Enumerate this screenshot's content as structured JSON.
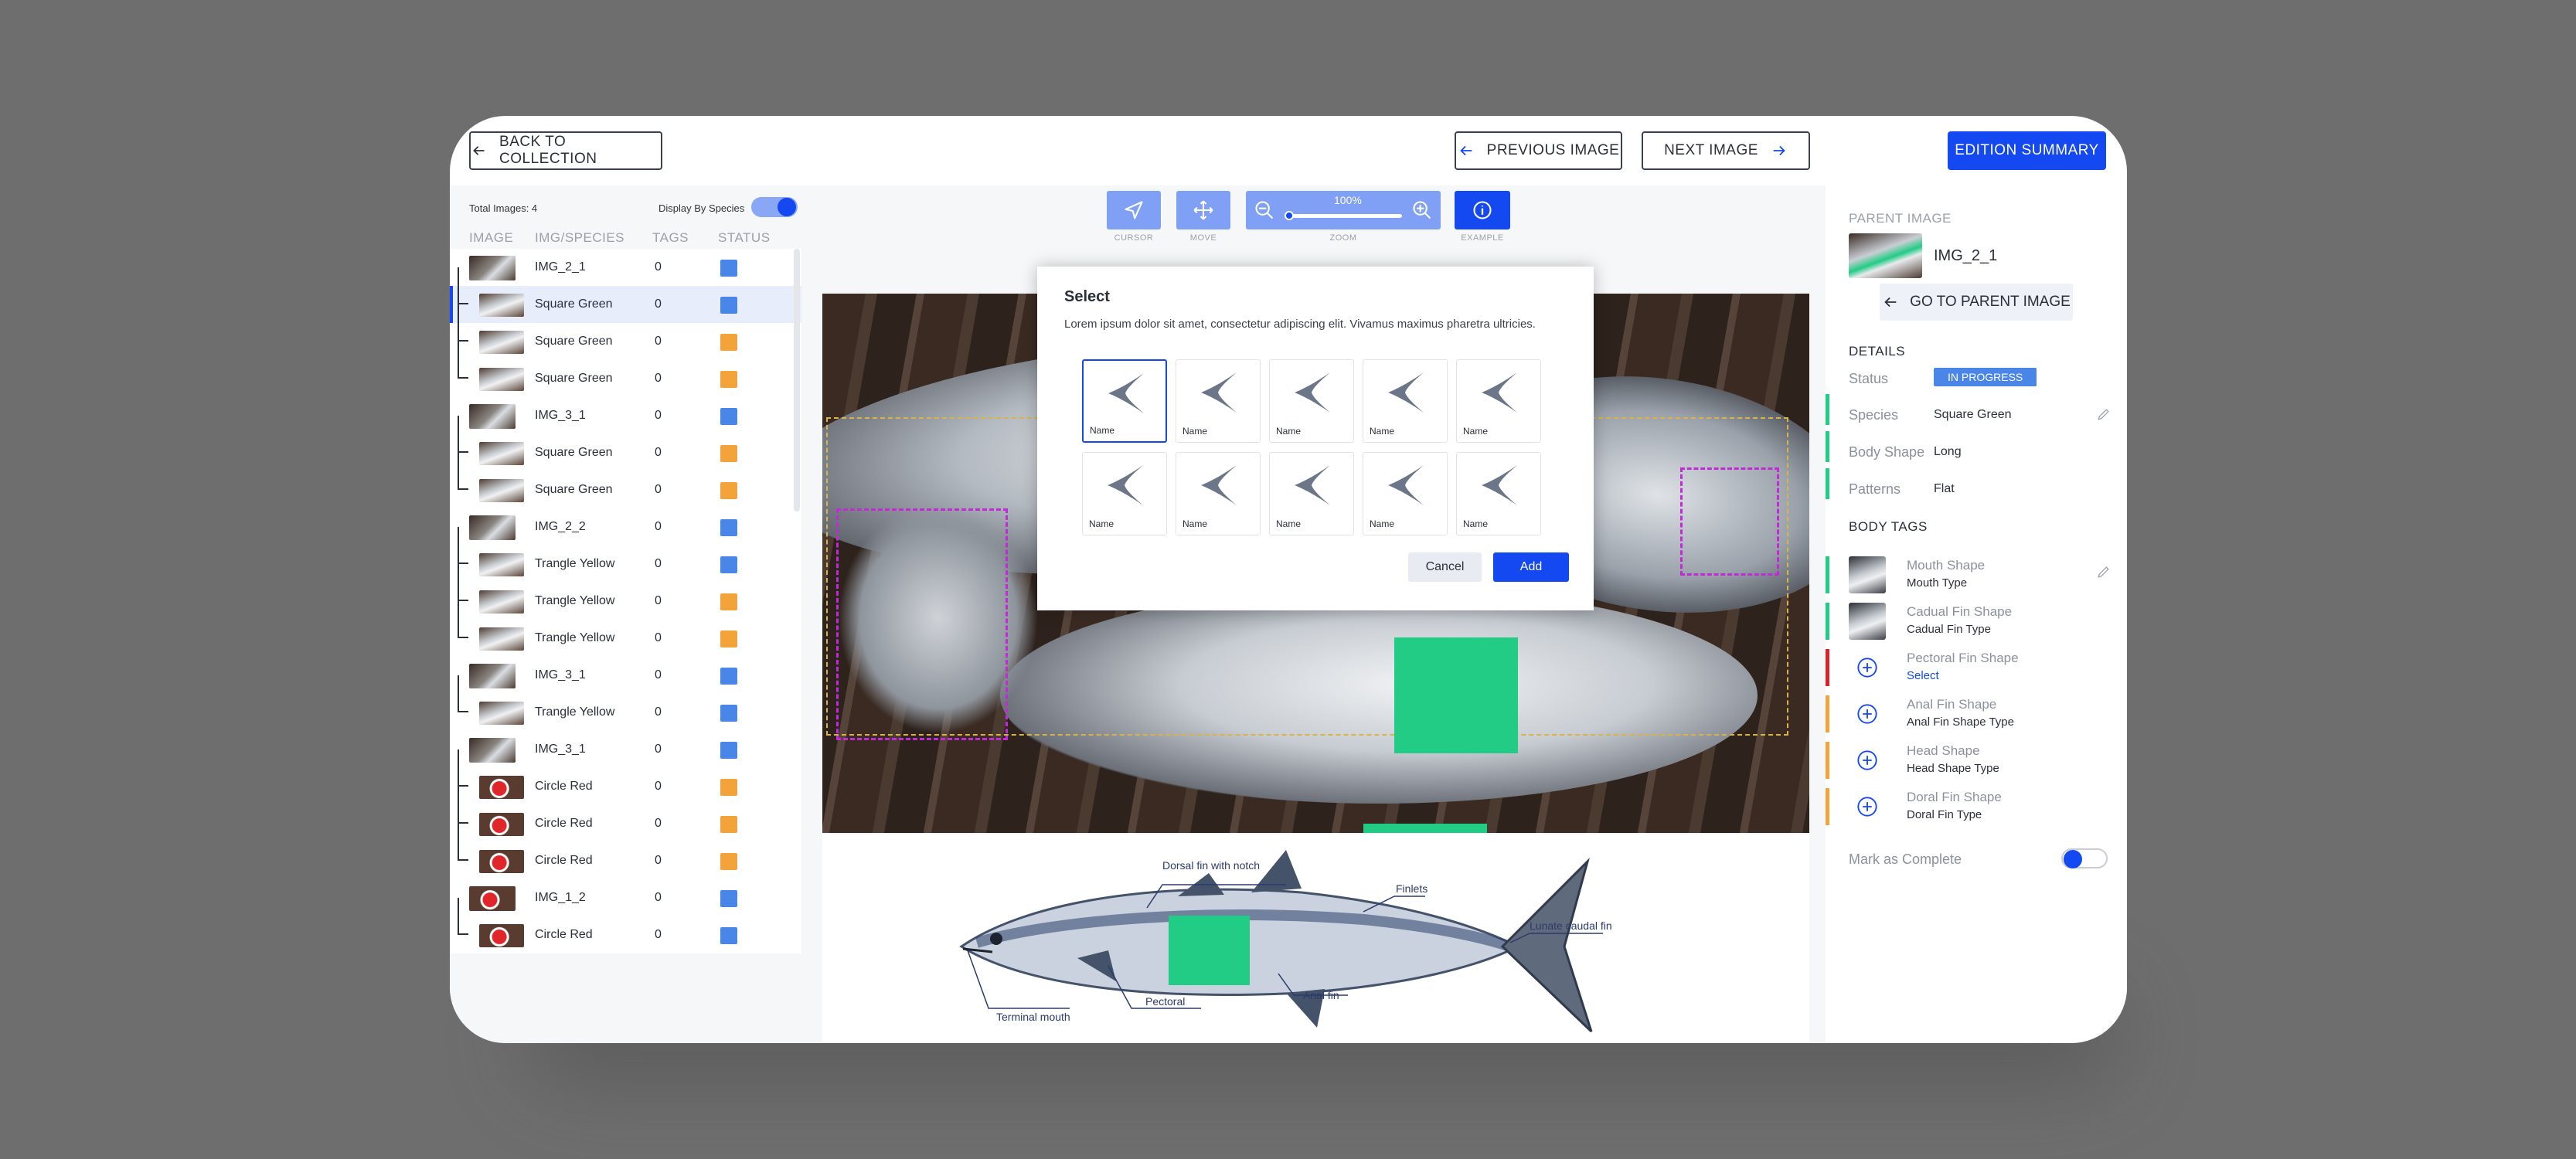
{
  "topbar": {
    "back_label": "BACK TO COLLECTION",
    "prev_label": "PREVIOUS IMAGE",
    "next_label": "NEXT IMAGE",
    "summary_label": "EDITION SUMMARY"
  },
  "left": {
    "total_images": "Total Images: 4",
    "display_by_species": "Display By Species",
    "display_by_species_on": true,
    "headers": [
      "IMAGE",
      "IMG/SPECIES",
      "TAGS",
      "STATUS"
    ],
    "rows": [
      {
        "name": "IMG_2_1",
        "tags": "0",
        "status": "blue",
        "child": false,
        "thumb": "fish"
      },
      {
        "name": "Square Green",
        "tags": "0",
        "status": "blue",
        "child": true,
        "thumb": "fish",
        "active": true
      },
      {
        "name": "Square Green",
        "tags": "0",
        "status": "orange",
        "child": true,
        "thumb": "fish"
      },
      {
        "name": "Square Green",
        "tags": "0",
        "status": "orange",
        "child": true,
        "thumb": "fish"
      },
      {
        "name": "IMG_3_1",
        "tags": "0",
        "status": "blue",
        "child": false,
        "thumb": "fish"
      },
      {
        "name": "Square Green",
        "tags": "0",
        "status": "orange",
        "child": true,
        "thumb": "fish"
      },
      {
        "name": "Square Green",
        "tags": "0",
        "status": "orange",
        "child": true,
        "thumb": "fish"
      },
      {
        "name": "IMG_2_2",
        "tags": "0",
        "status": "blue",
        "child": false,
        "thumb": "fish"
      },
      {
        "name": "Trangle Yellow",
        "tags": "0",
        "status": "blue",
        "child": true,
        "thumb": "fish"
      },
      {
        "name": "Trangle Yellow",
        "tags": "0",
        "status": "orange",
        "child": true,
        "thumb": "fish"
      },
      {
        "name": "Trangle Yellow",
        "tags": "0",
        "status": "orange",
        "child": true,
        "thumb": "fish"
      },
      {
        "name": "IMG_3_1",
        "tags": "0",
        "status": "blue",
        "child": false,
        "thumb": "fish"
      },
      {
        "name": "Trangle Yellow",
        "tags": "0",
        "status": "blue",
        "child": true,
        "thumb": "fish"
      },
      {
        "name": "IMG_3_1",
        "tags": "0",
        "status": "blue",
        "child": false,
        "thumb": "fish"
      },
      {
        "name": "Circle Red",
        "tags": "0",
        "status": "orange",
        "child": true,
        "thumb": "red"
      },
      {
        "name": "Circle Red",
        "tags": "0",
        "status": "orange",
        "child": true,
        "thumb": "red"
      },
      {
        "name": "Circle Red",
        "tags": "0",
        "status": "orange",
        "child": true,
        "thumb": "red"
      },
      {
        "name": "IMG_1_2",
        "tags": "0",
        "status": "blue",
        "child": false,
        "thumb": "red"
      },
      {
        "name": "Circle Red",
        "tags": "0",
        "status": "blue",
        "child": true,
        "thumb": "red"
      }
    ]
  },
  "toolbar": {
    "cursor_label": "CURSOR",
    "move_label": "MOVE",
    "zoom_label": "ZOOM",
    "zoom_value": "100%",
    "zoom_level": 0.0,
    "example_label": "EXAMPLE"
  },
  "modal": {
    "title": "Select",
    "description": "Lorem ipsum dolor sit amet, consectetur adipiscing elit. Vivamus maximus pharetra ultricies.",
    "options": [
      "Name",
      "Name",
      "Name",
      "Name",
      "Name",
      "Name",
      "Name",
      "Name",
      "Name",
      "Name"
    ],
    "selected_index": 0,
    "cancel_label": "Cancel",
    "add_label": "Add"
  },
  "diagram": {
    "labels": {
      "dorsal": "Dorsal fin with notch",
      "finlets": "Finlets",
      "caudal": "Lunate caudal fin",
      "anal": "Anal fin",
      "pectoral": "Pectoral",
      "mouth": "Terminal mouth"
    }
  },
  "right": {
    "parent_header": "PARENT IMAGE",
    "parent_name": "IMG_2_1",
    "go_parent_label": "GO TO PARENT IMAGE",
    "details_header": "DETAILS",
    "status_label": "Status",
    "status_value": "IN PROGRESS",
    "species_label": "Species",
    "species_value": "Square Green",
    "body_shape_label": "Body Shape",
    "body_shape_value": "Long",
    "patterns_label": "Patterns",
    "patterns_value": "Flat",
    "body_tags_header": "BODY TAGS",
    "tags": [
      {
        "title": "Mouth Shape",
        "sub": "Mouth Type",
        "state": "done"
      },
      {
        "title": "Cadual Fin Shape",
        "sub": "Cadual Fin Type",
        "state": "done"
      },
      {
        "title": "Pectoral Fin Shape",
        "sub": "Select",
        "state": "error"
      },
      {
        "title": "Anal Fin Shape",
        "sub": "Anal Fin Shape Type",
        "state": "pending"
      },
      {
        "title": "Head Shape",
        "sub": "Head Shape Type",
        "state": "pending"
      },
      {
        "title": "Doral Fin Shape",
        "sub": "Doral Fin Type",
        "state": "pending"
      }
    ],
    "mark_complete_label": "Mark as Complete",
    "mark_complete_on": false
  },
  "colors": {
    "primary": "#1448f0",
    "status_blue": "#4a86e8",
    "status_orange": "#f2a33a",
    "done_green": "#22cc85",
    "error_red": "#d8232a",
    "pending_orange": "#f2a33a",
    "selection_magenta": "#c02bd6"
  }
}
